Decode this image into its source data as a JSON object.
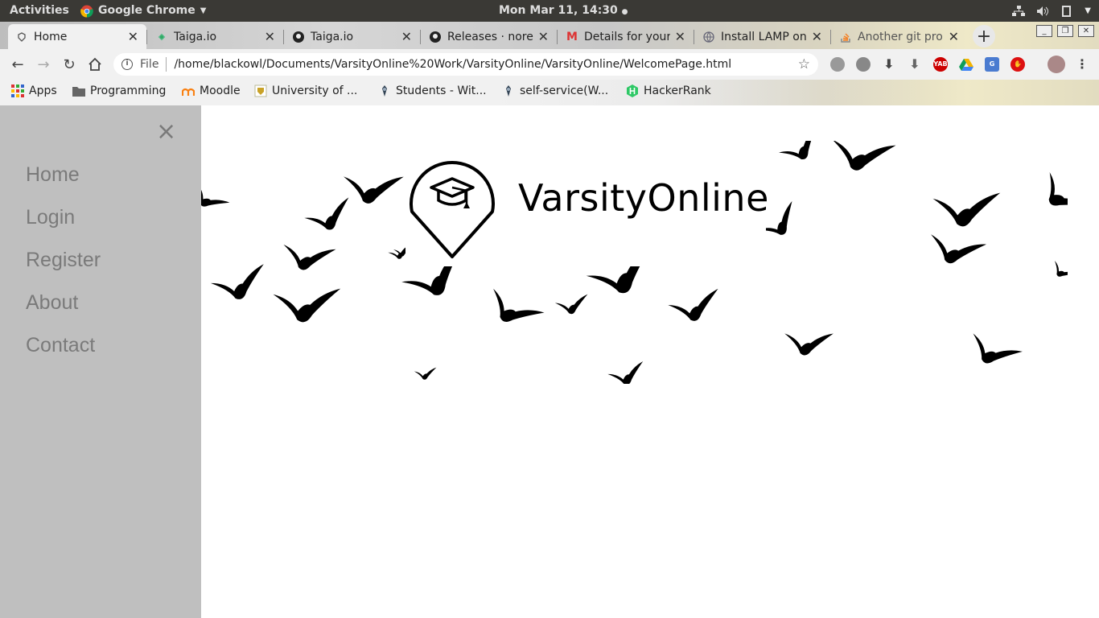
{
  "system": {
    "activities": "Activities",
    "app_name": "Google Chrome",
    "clock": "Mon Mar 11, 14:30"
  },
  "browser": {
    "tabs": [
      {
        "title": "Home",
        "icon": "page-icon",
        "active": true
      },
      {
        "title": "Taiga.io",
        "icon": "taiga-icon"
      },
      {
        "title": "Taiga.io",
        "icon": "github-icon"
      },
      {
        "title": "Releases · norep",
        "icon": "github-icon"
      },
      {
        "title": "Details for your",
        "icon": "gmail-icon"
      },
      {
        "title": "Install LAMP on",
        "icon": "globe-icon"
      },
      {
        "title": "Another git pro",
        "icon": "stackoverflow-icon"
      }
    ],
    "address": {
      "protocol_label": "File",
      "url": "/home/blackowl/Documents/VarsityOnline%20Work/VarsityOnline/VarsityOnline/WelcomePage.html"
    },
    "bookmarks": [
      {
        "label": "Apps",
        "icon": "apps-grid-icon"
      },
      {
        "label": "Programming",
        "icon": "folder-icon"
      },
      {
        "label": "Moodle",
        "icon": "moodle-icon"
      },
      {
        "label": "University of ...",
        "icon": "university-icon"
      },
      {
        "label": "Students - Wit...",
        "icon": "wits-icon"
      },
      {
        "label": "self-service(W...",
        "icon": "wits-icon"
      },
      {
        "label": "HackerRank",
        "icon": "hackerrank-icon"
      }
    ],
    "extensions": [
      "yab",
      "drive",
      "translate",
      "adblock"
    ]
  },
  "sidenav": {
    "close_label": "×",
    "links": [
      "Home",
      "Login",
      "Register",
      "About",
      "Contact"
    ]
  },
  "hero": {
    "brand": "VarsityOnline",
    "logo_icon": "graduation-cap-pin-icon"
  },
  "colors": {
    "sidenav_bg": "#bfbfbf",
    "nav_text": "#7a7a7a",
    "topbar_bg": "#3a3935"
  }
}
